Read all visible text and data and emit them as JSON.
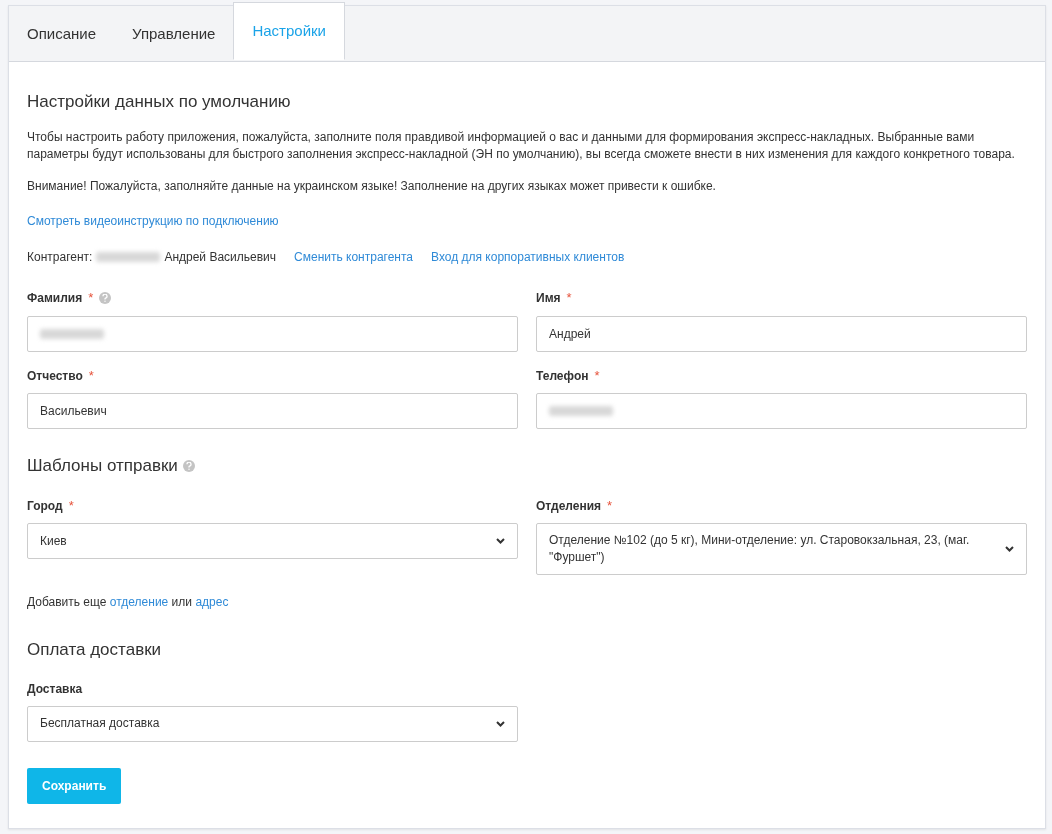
{
  "tabs": [
    {
      "label": "Описание",
      "selected": false
    },
    {
      "label": "Управление",
      "selected": false
    },
    {
      "label": "Настройки",
      "selected": true
    }
  ],
  "heading": "Настройки данных по умолчанию",
  "intro": "Чтобы настроить работу приложения, пожалуйста, заполните поля правдивой информацией о вас и данными для формирования экспресс-накладных. Выбранные вами параметры будут использованы для быстрого заполнения экспресс-накладной (ЭН по умолчанию), вы всегда сможете внести в них изменения для каждого конкретного товара.",
  "warning": "Внимание! Пожалуйста, заполняйте данные на украинском языке! Заполнение на других языках может привести к ошибке.",
  "video_link": "Смотреть видеоинструкцию по подключению",
  "contractor": {
    "label": "Контрагент:",
    "redacted": true,
    "name": "Андрей Васильевич",
    "links": [
      "Сменить контрагента",
      "Вход для корпоративных клиентов"
    ]
  },
  "personal_fields": [
    {
      "label": "Фамилия",
      "required_mark": "*",
      "help": true,
      "redacted": true
    },
    {
      "label": "Имя",
      "required_mark": "*",
      "help": false,
      "value": "Андрей",
      "redacted": false
    },
    {
      "label": "Отчество",
      "required_mark": "*",
      "help": false,
      "value": "Васильевич",
      "redacted": false
    },
    {
      "label": "Телефон",
      "required_mark": "*",
      "help": false,
      "redacted": true
    }
  ],
  "templates": {
    "title": "Шаблоны отправки",
    "help": true,
    "selects": [
      {
        "label": "Город",
        "required_mark": "*",
        "value": "Киев"
      },
      {
        "label": "Отделения",
        "required_mark": "*",
        "value": "Отделение №102 (до 5 кг), Мини-отделение: ул. Старовокзальная, 23, (маг. \"Фуршет\")"
      }
    ],
    "add_more": [
      {
        "kind": "text",
        "text": "Добавить еще"
      },
      {
        "kind": "link",
        "text": "отделение"
      },
      {
        "kind": "text",
        "text": "или"
      },
      {
        "kind": "link",
        "text": "адрес"
      }
    ]
  },
  "payment": {
    "title": "Оплата доставки",
    "select": {
      "label": "Доставка",
      "value": "Бесплатная доставка"
    }
  },
  "save_button": "Сохранить"
}
